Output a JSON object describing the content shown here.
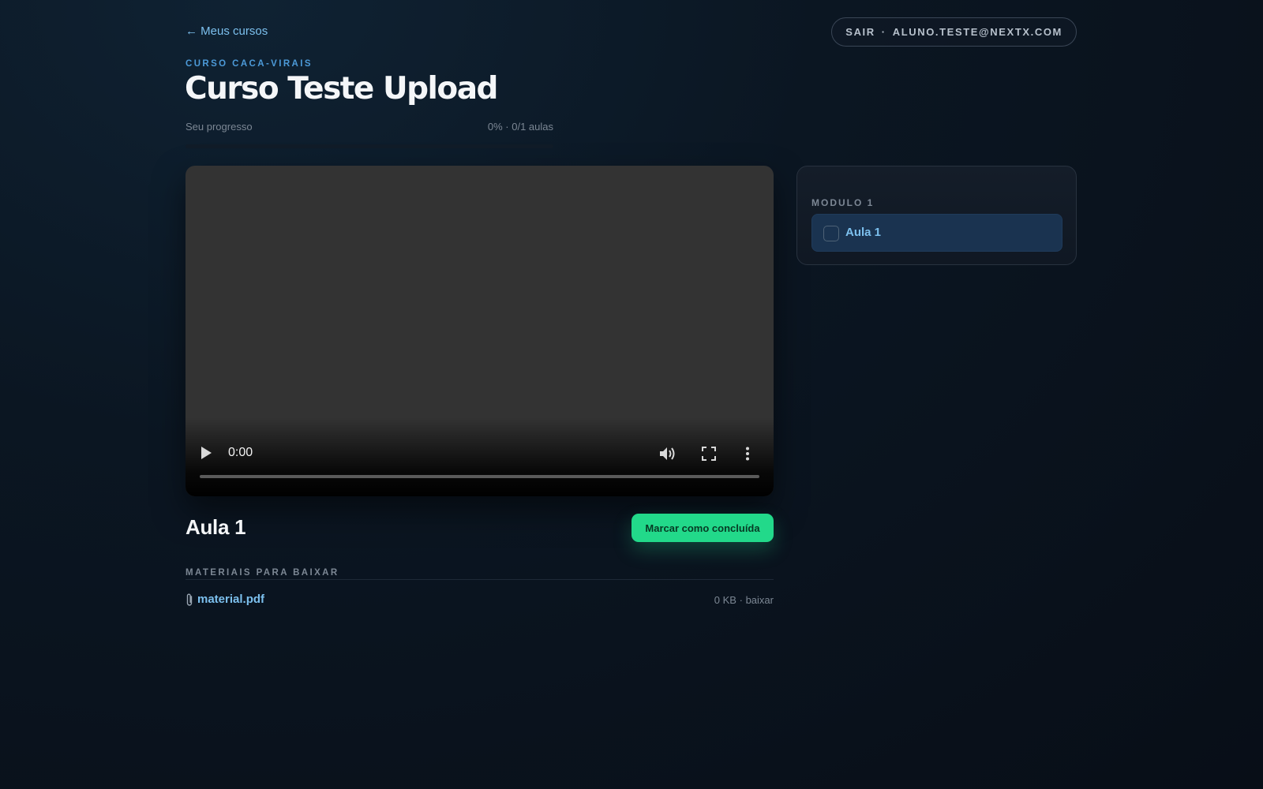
{
  "nav": {
    "back_label": "← Meus cursos"
  },
  "user": {
    "logout_label": "SAIR",
    "separator": "·",
    "email": "ALUNO.TESTE@NEXTX.COM"
  },
  "course": {
    "eyebrow": "CURSO CACA-VIRAIS",
    "title": "Curso Teste Upload",
    "progress_label": "Seu progresso",
    "progress_value": "0% · 0/1 aulas",
    "progress_fraction": 0
  },
  "player": {
    "current_time": "0:00",
    "played_fraction": 0,
    "icons": {
      "play": "play-icon",
      "volume": "volume-icon",
      "fullscreen": "fullscreen-icon",
      "more": "more-options-icon"
    }
  },
  "lesson": {
    "title": "Aula 1",
    "complete_button_label": "Marcar como concluída"
  },
  "materials": {
    "heading": "MATERIAIS PARA BAIXAR",
    "files": [
      {
        "name": "material.pdf",
        "size": "0 KB",
        "separator": "·",
        "action": "baixar",
        "icon": "paperclip-icon"
      }
    ]
  },
  "sidebar": {
    "modules": [
      {
        "title": "MODULO 1",
        "lessons": [
          {
            "label": "Aula 1",
            "completed": false,
            "active": true
          }
        ]
      }
    ]
  },
  "colors": {
    "accent": "#7cc0ee",
    "eyebrow": "#4c9ad8",
    "success": "#22d98a",
    "background": "#0b1622",
    "muted": "#7c8794"
  }
}
